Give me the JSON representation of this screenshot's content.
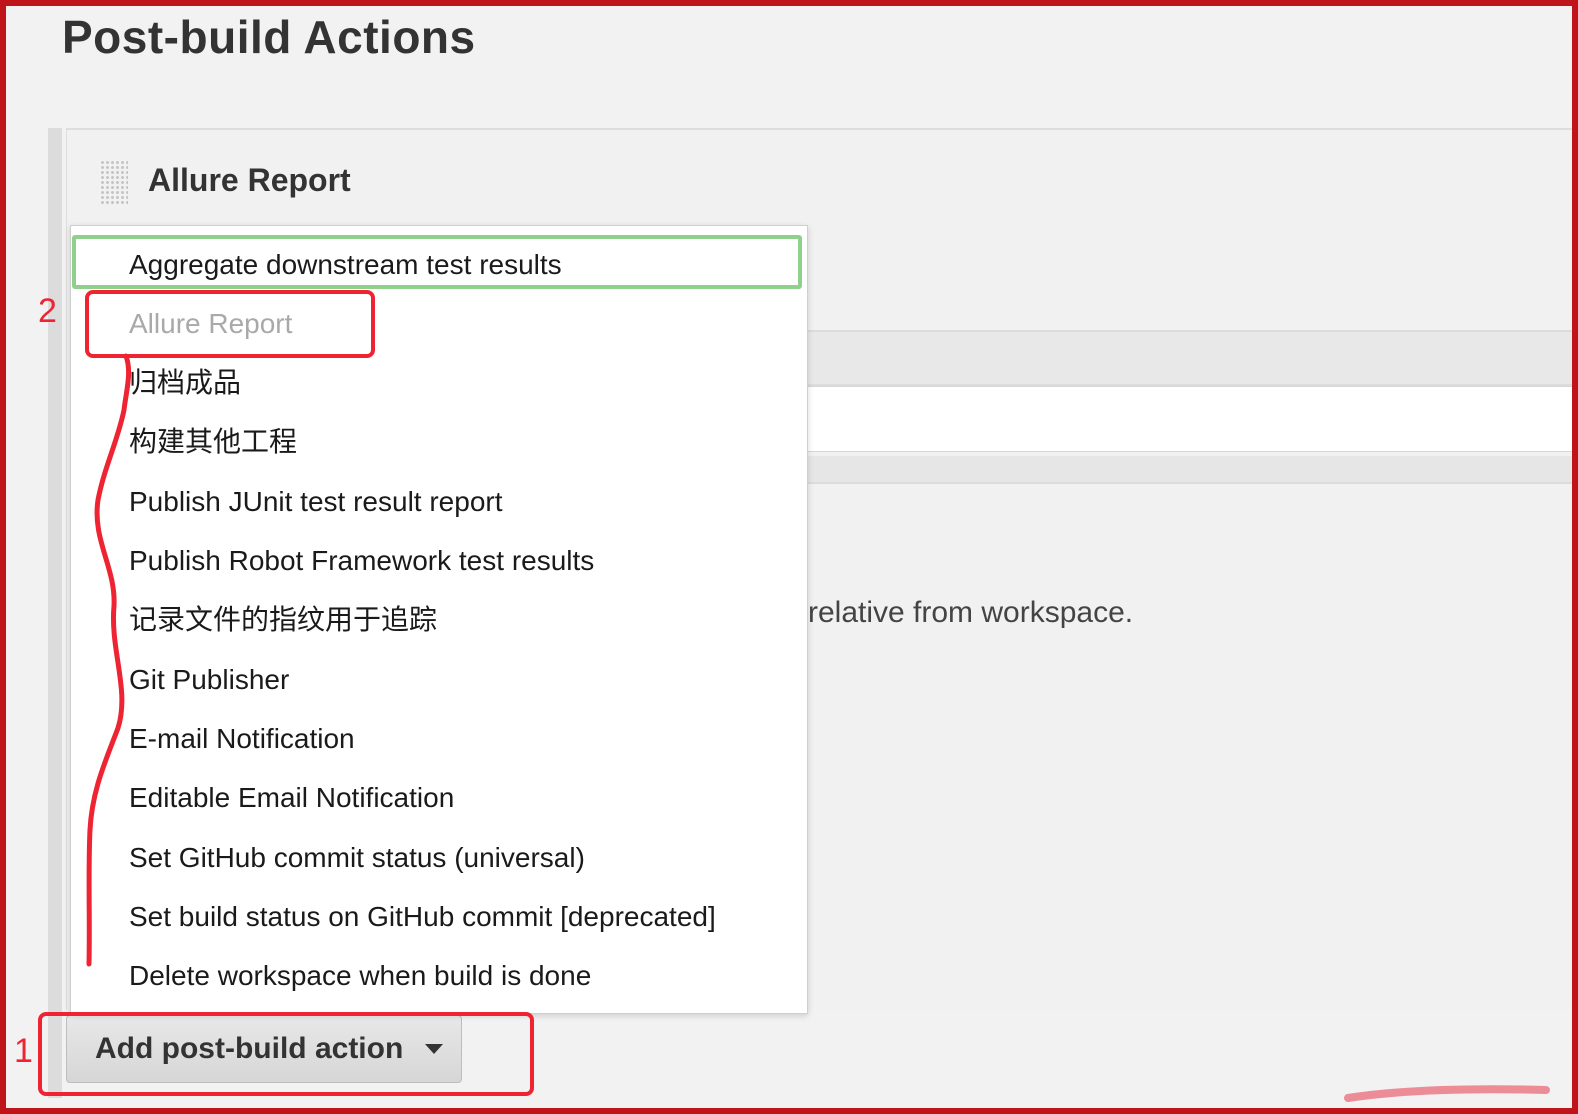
{
  "page": {
    "title": "Post-build Actions"
  },
  "section": {
    "heading": "Allure Report",
    "help_text": "relative from workspace."
  },
  "dropdown": {
    "items": [
      {
        "label": "Aggregate downstream test results",
        "enabled": true
      },
      {
        "label": "Allure Report",
        "enabled": false
      },
      {
        "label": "归档成品",
        "enabled": true
      },
      {
        "label": "构建其他工程",
        "enabled": true
      },
      {
        "label": "Publish JUnit test result report",
        "enabled": true
      },
      {
        "label": "Publish Robot Framework test results",
        "enabled": true
      },
      {
        "label": "记录文件的指纹用于追踪",
        "enabled": true
      },
      {
        "label": "Git Publisher",
        "enabled": true
      },
      {
        "label": "E-mail Notification",
        "enabled": true
      },
      {
        "label": "Editable Email Notification",
        "enabled": true
      },
      {
        "label": "Set GitHub commit status (universal)",
        "enabled": true
      },
      {
        "label": "Set build status on GitHub commit [deprecated]",
        "enabled": true
      },
      {
        "label": "Delete workspace when build is done",
        "enabled": true
      }
    ]
  },
  "add_button": {
    "label": "Add post-build action",
    "icon": "caret-down-icon"
  },
  "annotations": {
    "step1": "1",
    "step2": "2",
    "highlight_color": "#ee2433",
    "selected_highlight_color": "#8fd18c"
  },
  "colors": {
    "frame": "#c0141b",
    "disabled_text": "#a9a9a9"
  }
}
